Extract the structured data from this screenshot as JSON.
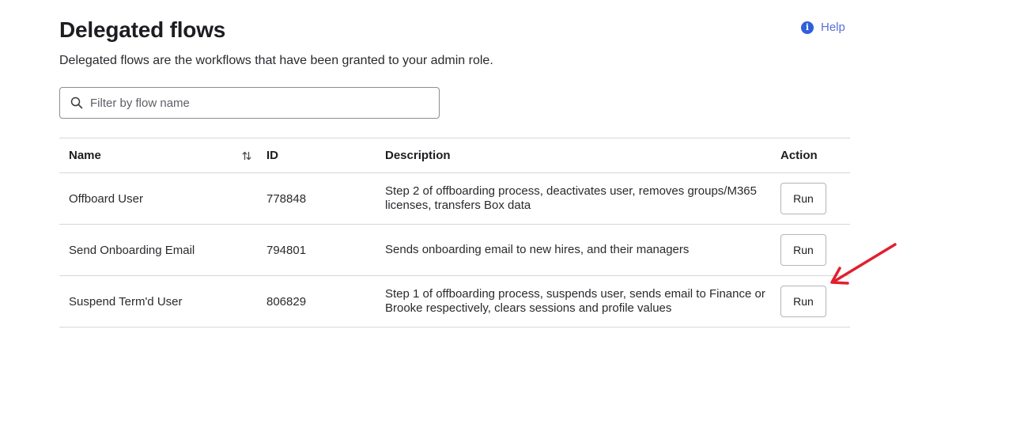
{
  "page": {
    "title": "Delegated flows",
    "subtitle": "Delegated flows are the workflows that have been granted to your admin role.",
    "help_label": "Help",
    "help_icon": "info-icon"
  },
  "search": {
    "placeholder": "Filter by flow name",
    "value": "",
    "icon": "search-icon"
  },
  "table": {
    "headers": {
      "name": "Name",
      "id": "ID",
      "description": "Description",
      "action": "Action"
    },
    "sort_icon": "sort-arrows-icon",
    "rows": [
      {
        "name": "Offboard User",
        "id": "778848",
        "description": "Step 2 of offboarding process, deactivates user, removes groups/M365 licenses, transfers Box data",
        "action_label": "Run"
      },
      {
        "name": "Send Onboarding Email",
        "id": "794801",
        "description": "Sends onboarding email to new hires, and their managers",
        "action_label": "Run"
      },
      {
        "name": "Suspend Term'd User",
        "id": "806829",
        "description": "Step 1 of offboarding process, suspends user, sends email to Finance or Brooke respectively, clears sessions and profile values",
        "action_label": "Run"
      }
    ]
  },
  "annotation": {
    "icon": "red-arrow-icon",
    "color": "#e0202e"
  },
  "colors": {
    "link": "#5a6fd6",
    "info_icon": "#2f5fd9",
    "border": "#d7d7dc"
  }
}
